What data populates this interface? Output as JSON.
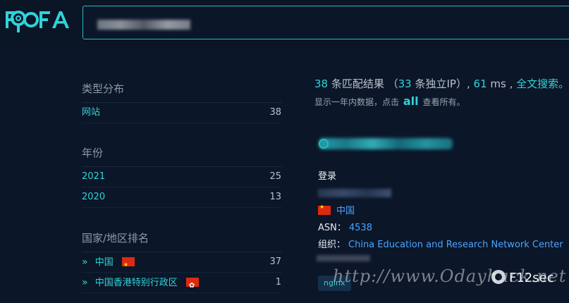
{
  "brand": {
    "logo_text": "FOFA"
  },
  "search": {
    "value": "",
    "placeholder": ""
  },
  "sidebar": {
    "type_section": {
      "title": "类型分布",
      "items": [
        {
          "label": "网站",
          "count": "38"
        }
      ]
    },
    "year_section": {
      "title": "年份",
      "items": [
        {
          "label": "2021",
          "count": "25"
        },
        {
          "label": "2020",
          "count": "13"
        }
      ]
    },
    "country_section": {
      "title": "国家/地区排名",
      "items": [
        {
          "label": "中国",
          "count": "37",
          "flag": "cn-flag"
        },
        {
          "label": "中国香港特别行政区",
          "count": "1",
          "flag": "hk-flag"
        }
      ]
    }
  },
  "results_summary": {
    "total": "38",
    "total_suffix": " 条匹配结果 （",
    "unique_ip": "33",
    "unique_ip_suffix": " 条独立IP）,",
    "time": "61",
    "time_suffix": " ms ,",
    "fulltext_link": "全文搜索。",
    "hint_prefix": "显示一年内数据，点击",
    "hint_all": "all",
    "hint_suffix": "查看所有。"
  },
  "result": {
    "title": "登录",
    "country": "中国",
    "asn_label": "ASN：",
    "asn_value": "4538",
    "org_label": "组织：",
    "org_value": "China Education and Research Network Center",
    "tag": "nginx"
  },
  "watermark": {
    "url_text": "http://www.Odayhack.net",
    "label": "F12sec"
  },
  "colors": {
    "background": "#0b1628",
    "accent": "#2fd3d8",
    "link_blue": "#4aa3ff",
    "border": "#2ab8c4"
  }
}
